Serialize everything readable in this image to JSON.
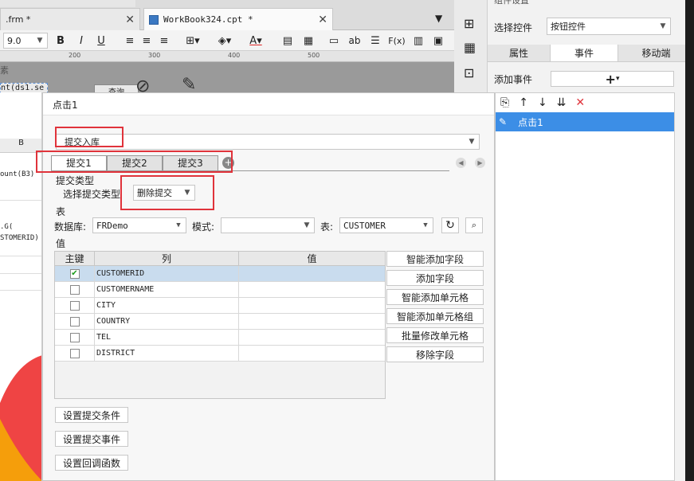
{
  "tabs": [
    {
      "label": ".frm *"
    },
    {
      "label": "WorkBook324.cpt *"
    }
  ],
  "toolbar": {
    "font_size": "9.0",
    "bold": "B",
    "italic": "I",
    "underline": "U",
    "text_color": "A"
  },
  "ruler": {
    "marks": [
      "200",
      "300",
      "400",
      "500"
    ]
  },
  "canvas": {
    "label1": "素",
    "formula": "nt(ds1.se",
    "button_text": "查询"
  },
  "sheet": {
    "col_b": "B",
    "cell_count": "ount(B3)",
    "cell_g": ".G(",
    "cell_id": "STOMERID)"
  },
  "right_panel": {
    "header_partial": "组件设置",
    "select_label": "选择控件",
    "select_value": "按钮控件",
    "tabs": [
      "属性",
      "事件",
      "移动端"
    ],
    "add_event_label": "添加事件",
    "add_event_btn": "+",
    "event_item": "点击1"
  },
  "dialog": {
    "title": "点击1",
    "submit_type_dropdown": "提交入库",
    "sub_tabs": [
      "提交1",
      "提交2",
      "提交3"
    ],
    "submit_type_section": "提交类型",
    "select_submit_type_label": "选择提交类型",
    "select_submit_type_value": "删除提交",
    "table_section": "表",
    "db_label": "数据库:",
    "db_value": "FRDemo",
    "schema_label": "模式:",
    "schema_value": "",
    "table_label": "表:",
    "table_value": "CUSTOMER",
    "value_section": "值",
    "grid_headers": [
      "主键",
      "列",
      "值"
    ],
    "grid_rows": [
      {
        "key": true,
        "col": "CUSTOMERID",
        "val": ""
      },
      {
        "key": false,
        "col": "CUSTOMERNAME",
        "val": ""
      },
      {
        "key": false,
        "col": "CITY",
        "val": ""
      },
      {
        "key": false,
        "col": "COUNTRY",
        "val": ""
      },
      {
        "key": false,
        "col": "TEL",
        "val": ""
      },
      {
        "key": false,
        "col": "DISTRICT",
        "val": ""
      }
    ],
    "side_buttons": [
      "智能添加字段",
      "添加字段",
      "智能添加单元格",
      "智能添加单元格组",
      "批量修改单元格",
      "移除字段"
    ],
    "bottom_buttons": [
      "设置提交条件",
      "设置提交事件",
      "设置回调函数"
    ]
  },
  "colors": {
    "accent": "#3c8ee6",
    "red_highlight": "#e0333b",
    "selected_row": "#c9dcee"
  }
}
